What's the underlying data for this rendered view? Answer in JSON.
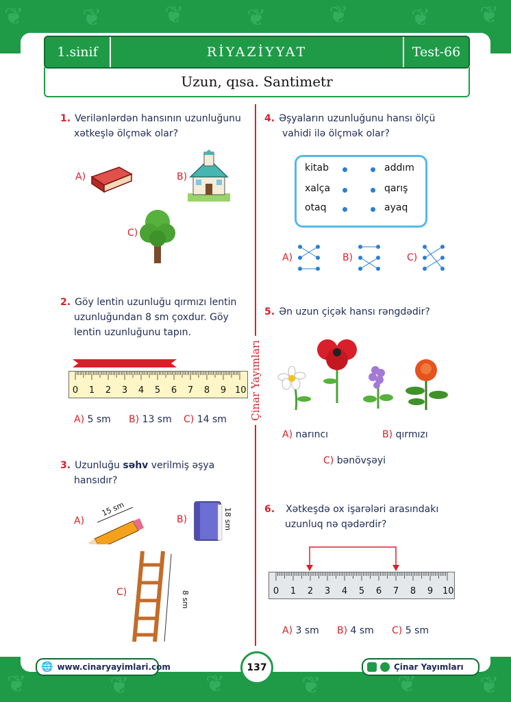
{
  "header": {
    "grade": "1.sinif",
    "subject": "RİYAZİYYAT",
    "test": "Test-66"
  },
  "subtitle": "Uzun, qısa. Santimetr",
  "vertical_brand": "Çinar Yayımları",
  "q1": {
    "num": "1.",
    "text1": "Verilənlərdən hansının uzunluğunu",
    "text2": "xətkeşlə ölçmək olar?",
    "a": "A)",
    "b": "B)",
    "c": "C)"
  },
  "q2": {
    "num": "2.",
    "text1": "Göy lentin uzunluğu qırmızı lentin",
    "text2": "uzunluğundan 8 sm çoxdur. Göy",
    "text3": "lentin uzunluğunu tapın.",
    "a_l": "A)",
    "a_v": "5 sm",
    "b_l": "B)",
    "b_v": "13 sm",
    "c_l": "C)",
    "c_v": "14 sm"
  },
  "ruler_numbers": [
    "0",
    "1",
    "2",
    "3",
    "4",
    "5",
    "6",
    "7",
    "8",
    "9",
    "10"
  ],
  "q3": {
    "num": "3.",
    "pre": "Uzunluğu ",
    "bold": "səhv",
    "post": " verilmiş əşya",
    "text2": "hansıdır?",
    "a": "A)",
    "b": "B)",
    "c": "C)",
    "pencil": "15 sm",
    "book": "18 sm",
    "ladder": "8 sm"
  },
  "q4": {
    "num": "4.",
    "text1": "Əşyaların uzunluğunu hansı ölçü",
    "text2": "vahidi ilə ölçmək olar?",
    "left": [
      "kitab",
      "xalça",
      "otaq"
    ],
    "right": [
      "addım",
      "qarış",
      "ayaq"
    ],
    "a": "A)",
    "b": "B)",
    "c": "C)"
  },
  "q5": {
    "num": "5.",
    "text": "Ən uzun çiçək hansı rəngdədir?",
    "a_l": "A)",
    "a_v": "narıncı",
    "b_l": "B)",
    "b_v": "qırmızı",
    "c_l": "C)",
    "c_v": "bənövşəyi"
  },
  "q6": {
    "num": "6.",
    "text1": "Xətkeşdə ox işarələri arasındakı",
    "text2": "uzunluq nə qədərdir?",
    "a_l": "A)",
    "a_v": "3 sm",
    "b_l": "B)",
    "b_v": "4 sm",
    "c_l": "C)",
    "c_v": "5 sm"
  },
  "footer": {
    "website": "www.cinaryayimlari.com",
    "page": "137",
    "brand": "Çinar Yayımları"
  },
  "colors": {
    "green": "#1f9b48",
    "red": "#d8202a",
    "navy": "#1e2a55",
    "blue": "#55b9e6"
  }
}
